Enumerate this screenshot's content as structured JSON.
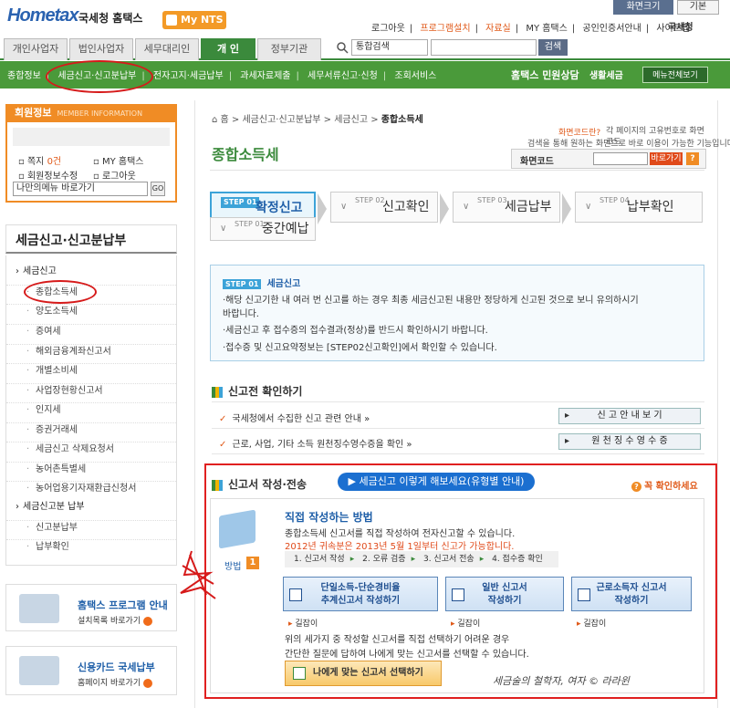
{
  "header": {
    "logo": "Hometax",
    "site_name": "국세청 홈택스",
    "my_nts": "My NTS",
    "font_size": "화면크기",
    "basic": "기본",
    "util_links": [
      "로그아웃",
      "프로그램설치",
      "자료실",
      "MY 홈택스",
      "공인인증서안내",
      "사이트맵"
    ],
    "util_highlight": [
      1,
      2
    ],
    "nts_logo": "국세청"
  },
  "tabs": [
    "개인사업자",
    "법인사업자",
    "세무대리인",
    "개 인",
    "정부기관"
  ],
  "active_tab": 3,
  "search": {
    "select": "통합검색",
    "value": "",
    "button": "검색"
  },
  "subnav": [
    "종합정보",
    "세금신고·신고분납부",
    "전자고지·세금납부",
    "과세자료제출",
    "세무서류신고·신청",
    "조회서비스"
  ],
  "civil": "홈택스 민원상담",
  "life_tax": "생활세금",
  "all_menu": "메뉴전체보기",
  "member": {
    "title": "회원정보",
    "title_en": "MEMBER INFORMATION",
    "memo": "쪽지",
    "memo_count": "0건",
    "my_hometax": "MY 홈택스",
    "edit": "회원정보수정",
    "logout": "로그아웃",
    "quickmenu": "나만의메뉴 바로가기",
    "go": "GO"
  },
  "left_menu": {
    "title": "세금신고·신고분납부",
    "items": [
      {
        "label": "세금신고",
        "level": "main"
      },
      {
        "label": "종합소득세",
        "level": "sub"
      },
      {
        "label": "양도소득세",
        "level": "sub"
      },
      {
        "label": "증여세",
        "level": "sub"
      },
      {
        "label": "해외금융계좌신고서",
        "level": "sub"
      },
      {
        "label": "개별소비세",
        "level": "sub"
      },
      {
        "label": "사업장현황신고서",
        "level": "sub"
      },
      {
        "label": "인지세",
        "level": "sub"
      },
      {
        "label": "증권거래세",
        "level": "sub"
      },
      {
        "label": "세금신고 삭제요청서",
        "level": "sub"
      },
      {
        "label": "농어촌특별세",
        "level": "sub"
      },
      {
        "label": "농어업용기자재환급신청서",
        "level": "sub"
      },
      {
        "label": "세금신고분 납부",
        "level": "main"
      },
      {
        "label": "신고분납부",
        "level": "sub"
      },
      {
        "label": "납부확인",
        "level": "sub"
      }
    ]
  },
  "banners": {
    "program_title": "홈택스 프로그램 안내",
    "program_sub": "설치목록 바로가기",
    "card_title": "신용카드 국세납부",
    "card_sub": "홈페이지 바로가기"
  },
  "breadcrumb": [
    "홈",
    "세금신고·신고분납부",
    "세금신고",
    "종합소득세"
  ],
  "page_title": "종합소득세",
  "screen_code": {
    "q": "화면코드란?",
    "desc": "각 페이지의 고유번호로 화면코드",
    "desc2": "검색을 통해 원하는 화면으로 바로 이용이 가능한 기능입니다.",
    "label": "화면코드",
    "value": "",
    "button": "바로가기",
    "help": "?"
  },
  "steps": [
    {
      "no": "STEP 01",
      "label": "확정신고",
      "active": true
    },
    {
      "no": "STEP 02",
      "label": "신고확인",
      "active": false
    },
    {
      "no": "STEP 03",
      "label": "세금납부",
      "active": false
    },
    {
      "no": "STEP 04",
      "label": "납부확인",
      "active": false
    },
    {
      "no": "STEP 01",
      "label": "중간예납",
      "active": false
    }
  ],
  "info": {
    "badge": "STEP 01",
    "title": "세금신고",
    "lines": [
      "·해당 신고기한 내 여러 번 신고를 하는 경우 최종 세금신고된 내용만 정당하게 신고된 것으로 보니 유의하시기",
      "  바랍니다.",
      "·세금신고 후 접수증의 접수결과(정상)를 반드시 확인하시기 바랍니다.",
      "·접수증 및 신고요약정보는 [STEP02신고확인]에서 확인할 수 있습니다."
    ]
  },
  "pre_check": {
    "title": "신고전 확인하기",
    "rows": [
      {
        "text": "국세청에서 수집한 신고 관련 안내 »",
        "button": "신 고 안 내 보 기"
      },
      {
        "text": "근로, 사업, 기타 소득 원천징수영수증을 확인 »",
        "button": "원 천 징 수 영 수 증"
      }
    ]
  },
  "write": {
    "title": "신고서 작성·전송",
    "how_button": "세금신고 이렇게 해보세요(유형별 안내)",
    "check": "꼭 확인하세요",
    "method_label": "방법",
    "method_num": "1",
    "direct_title": "직접 작성하는 방법",
    "direct_desc": "종합소득세 신고서를 직접 작성하여 전자신고할 수 있습니다.",
    "direct_notice": "2012년 귀속분은 2013년 5월 1일부터 신고가 가능합니다.",
    "flow": [
      "1. 신고서 작성",
      "2. 오류 검증",
      "3. 신고서 전송",
      "4. 접수증 확인"
    ],
    "buttons": [
      {
        "line1": "단일소득-단순경비율",
        "line2": "추계신고서 작성하기"
      },
      {
        "line1": "일반 신고서",
        "line2": "작성하기"
      },
      {
        "line1": "근로소득자 신고서",
        "line2": "작성하기"
      }
    ],
    "guide": "길잡이",
    "note1": "위의 세가지 중 작성할 신고서를 직접 선택하기 어려운 경우",
    "note2": "간단한 질문에 답하여 나에게 맞는 신고서를 선택할 수 있습니다.",
    "pick_button": "나에게 맞는 신고서 선택하기"
  },
  "signature": "세금술의 철학자, 여자 © 라라윈",
  "colors": {
    "green": "#3b8a3c",
    "orange": "#f08c25",
    "blue": "#1f5fa8",
    "annotation_red": "#e02020"
  }
}
